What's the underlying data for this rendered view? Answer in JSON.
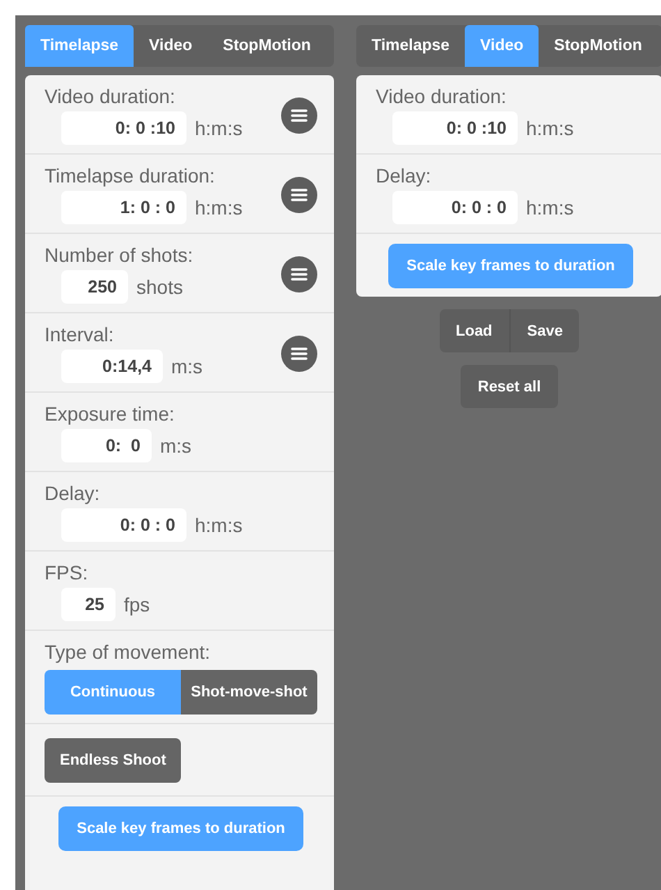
{
  "left": {
    "tabs": [
      {
        "label": "Timelapse",
        "selected": true
      },
      {
        "label": "Video",
        "selected": false
      },
      {
        "label": "StopMotion",
        "selected": false
      }
    ],
    "sections": [
      {
        "kind": "field",
        "label": "Video duration:",
        "value": "0: 0 :10",
        "unit": "h:m:s",
        "menu": true
      },
      {
        "kind": "field",
        "label": "Timelapse duration:",
        "value": "1: 0 : 0",
        "unit": "h:m:s",
        "menu": true
      },
      {
        "kind": "field",
        "label": "Number of shots:",
        "value": "250",
        "unit": "shots",
        "menu": true
      },
      {
        "kind": "field",
        "label": "Interval:",
        "value": "0:14,4",
        "unit": "m:s",
        "menu": true
      },
      {
        "kind": "field",
        "label": "Exposure time:",
        "value": "0:  0",
        "unit": "m:s",
        "menu": false
      },
      {
        "kind": "field",
        "label": "Delay:",
        "value": "0: 0 : 0",
        "unit": "h:m:s",
        "menu": false
      },
      {
        "kind": "field",
        "label": "FPS:",
        "value": "25",
        "unit": "fps",
        "menu": false
      },
      {
        "kind": "segmented",
        "label": "Type of movement:",
        "options": [
          {
            "label": "Continuous",
            "selected": true
          },
          {
            "label": "Shot-move-shot",
            "selected": false
          }
        ]
      },
      {
        "kind": "toggle",
        "label": "Endless Shoot",
        "on": false
      },
      {
        "kind": "action",
        "label": "Scale key frames to duration"
      }
    ]
  },
  "right": {
    "tabs": [
      {
        "label": "Timelapse",
        "selected": false
      },
      {
        "label": "Video",
        "selected": true
      },
      {
        "label": "StopMotion",
        "selected": false
      }
    ],
    "sections": [
      {
        "kind": "field",
        "label": "Video duration:",
        "value": "0: 0 :10",
        "unit": "h:m:s",
        "menu": false
      },
      {
        "kind": "field",
        "label": "Delay:",
        "value": "0: 0 : 0",
        "unit": "h:m:s",
        "menu": false
      },
      {
        "kind": "action",
        "label": "Scale key frames to duration"
      }
    ],
    "file_buttons": [
      "Load",
      "Save"
    ],
    "reset_button": "Reset all"
  }
}
